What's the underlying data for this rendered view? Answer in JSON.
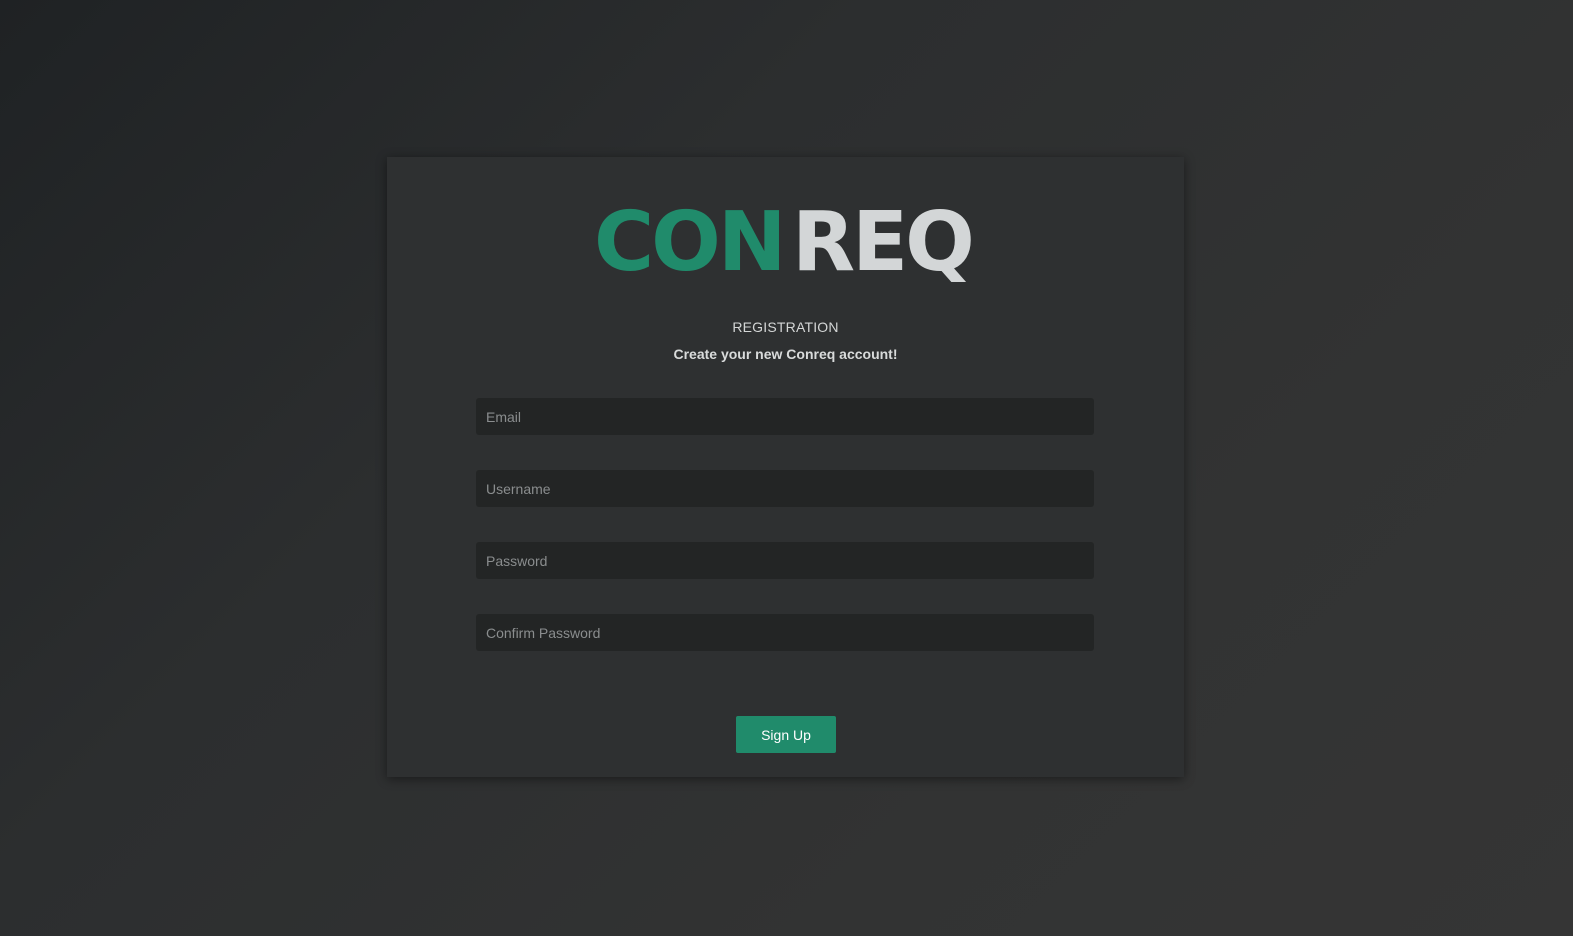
{
  "logo": {
    "part1": "CON",
    "part2": "REQ",
    "part1_color": "#208b6b",
    "part2_color": "#d3d6d7"
  },
  "form": {
    "heading": "REGISTRATION",
    "subheading": "Create your new Conreq account!",
    "fields": {
      "email": {
        "placeholder": "Email",
        "value": ""
      },
      "username": {
        "placeholder": "Username",
        "value": ""
      },
      "password": {
        "placeholder": "Password",
        "value": ""
      },
      "confirm_password": {
        "placeholder": "Confirm Password",
        "value": ""
      }
    },
    "submit_label": "Sign Up"
  },
  "colors": {
    "accent": "#208b6b",
    "card_background": "#2e3031",
    "input_background": "#232525"
  }
}
